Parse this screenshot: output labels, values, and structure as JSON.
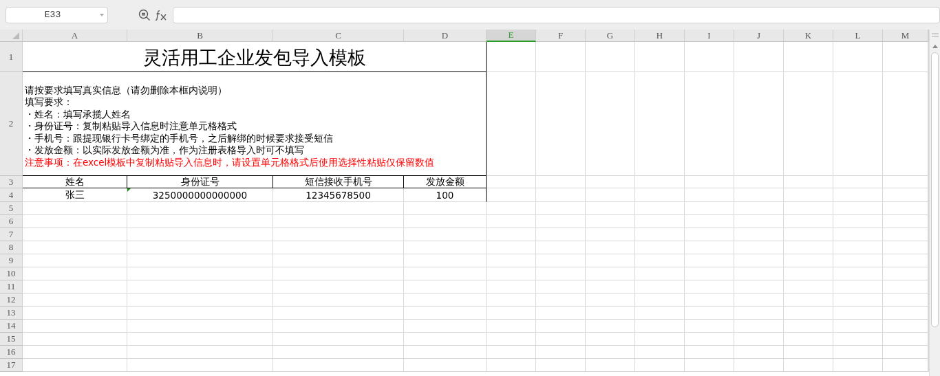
{
  "name_box": {
    "value": "E33"
  },
  "columns": [
    {
      "label": "A",
      "selected": false
    },
    {
      "label": "B",
      "selected": false
    },
    {
      "label": "C",
      "selected": false
    },
    {
      "label": "D",
      "selected": false
    },
    {
      "label": "E",
      "selected": true
    },
    {
      "label": "F",
      "selected": false
    },
    {
      "label": "G",
      "selected": false
    },
    {
      "label": "H",
      "selected": false
    },
    {
      "label": "I",
      "selected": false
    },
    {
      "label": "J",
      "selected": false
    },
    {
      "label": "K",
      "selected": false
    },
    {
      "label": "L",
      "selected": false
    },
    {
      "label": "M",
      "selected": false
    }
  ],
  "row_numbers": [
    "1",
    "2",
    "3",
    "4",
    "5",
    "6",
    "7",
    "8",
    "9",
    "10",
    "11",
    "12",
    "13",
    "14",
    "15",
    "16",
    "17"
  ],
  "title": "灵活用工企业发包导入模板",
  "notes": [
    {
      "kind": "normal",
      "text": "请按要求填写真实信息（请勿删除本框内说明）"
    },
    {
      "kind": "normal",
      "text": "填写要求："
    },
    {
      "kind": "normal",
      "text": "・姓名：填写承揽人姓名"
    },
    {
      "kind": "normal",
      "text": "・身份证号：复制粘贴导入信息时注意单元格格式"
    },
    {
      "kind": "normal",
      "text": "・手机号：跟提现银行卡号绑定的手机号，之后解绑的时候要求接受短信"
    },
    {
      "kind": "normal",
      "text": "・发放金额：以实际发放金额为准，作为注册表格导入时可不填写"
    },
    {
      "kind": "warning",
      "text": "注意事项：在excel模板中复制粘贴导入信息时，请设置单元格格式后使用选择性粘贴仅保留数值"
    }
  ],
  "table": {
    "columns": [
      "姓名",
      "身份证号",
      "短信接收手机号",
      "发放金额"
    ],
    "rows": [
      {
        "cells": [
          {
            "text": "张三",
            "flagged": false
          },
          {
            "text": "3250000000000000",
            "flagged": true
          },
          {
            "text": "12345678500",
            "flagged": false
          },
          {
            "text": "100",
            "flagged": false
          }
        ]
      }
    ]
  }
}
